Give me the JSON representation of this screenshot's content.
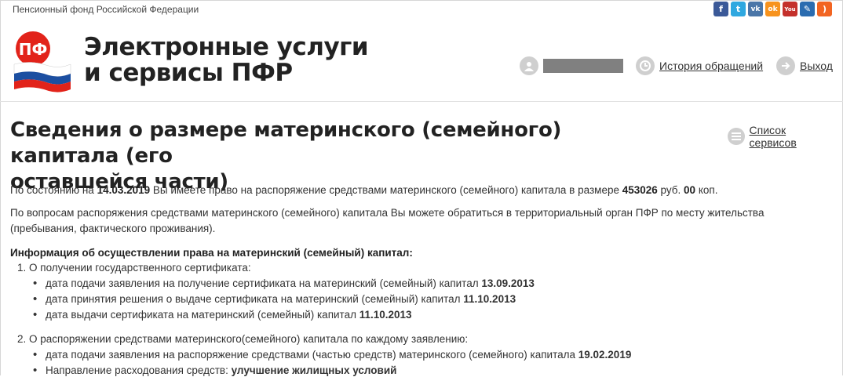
{
  "topbar": {
    "org_name": "Пенсионный фонд Российской Федерации",
    "social": [
      {
        "name": "facebook-icon",
        "glyph": "f",
        "color": "#3b5998"
      },
      {
        "name": "twitter-icon",
        "glyph": "t",
        "color": "#2fa8e0"
      },
      {
        "name": "vk-icon",
        "glyph": "vk",
        "color": "#4a76a8"
      },
      {
        "name": "odnoklassniki-icon",
        "glyph": "ok",
        "color": "#f7931e"
      },
      {
        "name": "youtube-icon",
        "glyph": "You",
        "color": "#c4302b"
      },
      {
        "name": "livejournal-icon",
        "glyph": "✎",
        "color": "#2b6cb0"
      },
      {
        "name": "rss-icon",
        "glyph": ")",
        "color": "#f26522"
      }
    ]
  },
  "header": {
    "brand_line1": "Электронные услуги",
    "brand_line2": "и сервисы ПФР",
    "history_label": "История обращений",
    "logout_label": "Выход"
  },
  "main": {
    "title_line1": "Сведения о размере материнского (семейного) капитала (его",
    "title_line2": "оставшейся части)",
    "services_link": "Список сервисов",
    "status": {
      "prefix": "По состоянию на ",
      "date": "14.03.2019",
      "middle": " Вы имеете право на распоряжение средствами материнского (семейного) капитала в размере ",
      "amount": "453026",
      "rub": " руб. ",
      "kop_value": "00",
      "kop": " коп."
    },
    "contact_line1": "По вопросам распоряжения средствами материнского (семейного) капитала Вы можете обратиться в территориальный орган ПФР по месту жительства",
    "contact_line2": "(пребывания, фактического проживания).",
    "info_heading": "Информация об осуществлении права на материнский (семейный) капитал:",
    "section1": {
      "label": "1. О получении государственного сертификата:",
      "items": [
        {
          "text": "дата подачи заявления на получение сертификата на материнский (семейный) капитал ",
          "value": "13.09.2013"
        },
        {
          "text": "дата принятия решения о выдаче сертификата на материнский (семейный) капитал ",
          "value": "11.10.2013"
        },
        {
          "text": "дата выдачи сертификата на материнский (семейный) капитал ",
          "value": "11.10.2013"
        }
      ]
    },
    "section2": {
      "label": "2. О распоряжении средствами материнского(семейного) капитала по каждому заявлению:",
      "items": [
        {
          "text": "дата подачи заявления на распоряжение средствами (частью средств) материнского (семейного) капитала ",
          "value": "19.02.2019"
        },
        {
          "text": "Направление расходования средств: ",
          "value": "улучшение жилищных условий"
        }
      ]
    }
  }
}
